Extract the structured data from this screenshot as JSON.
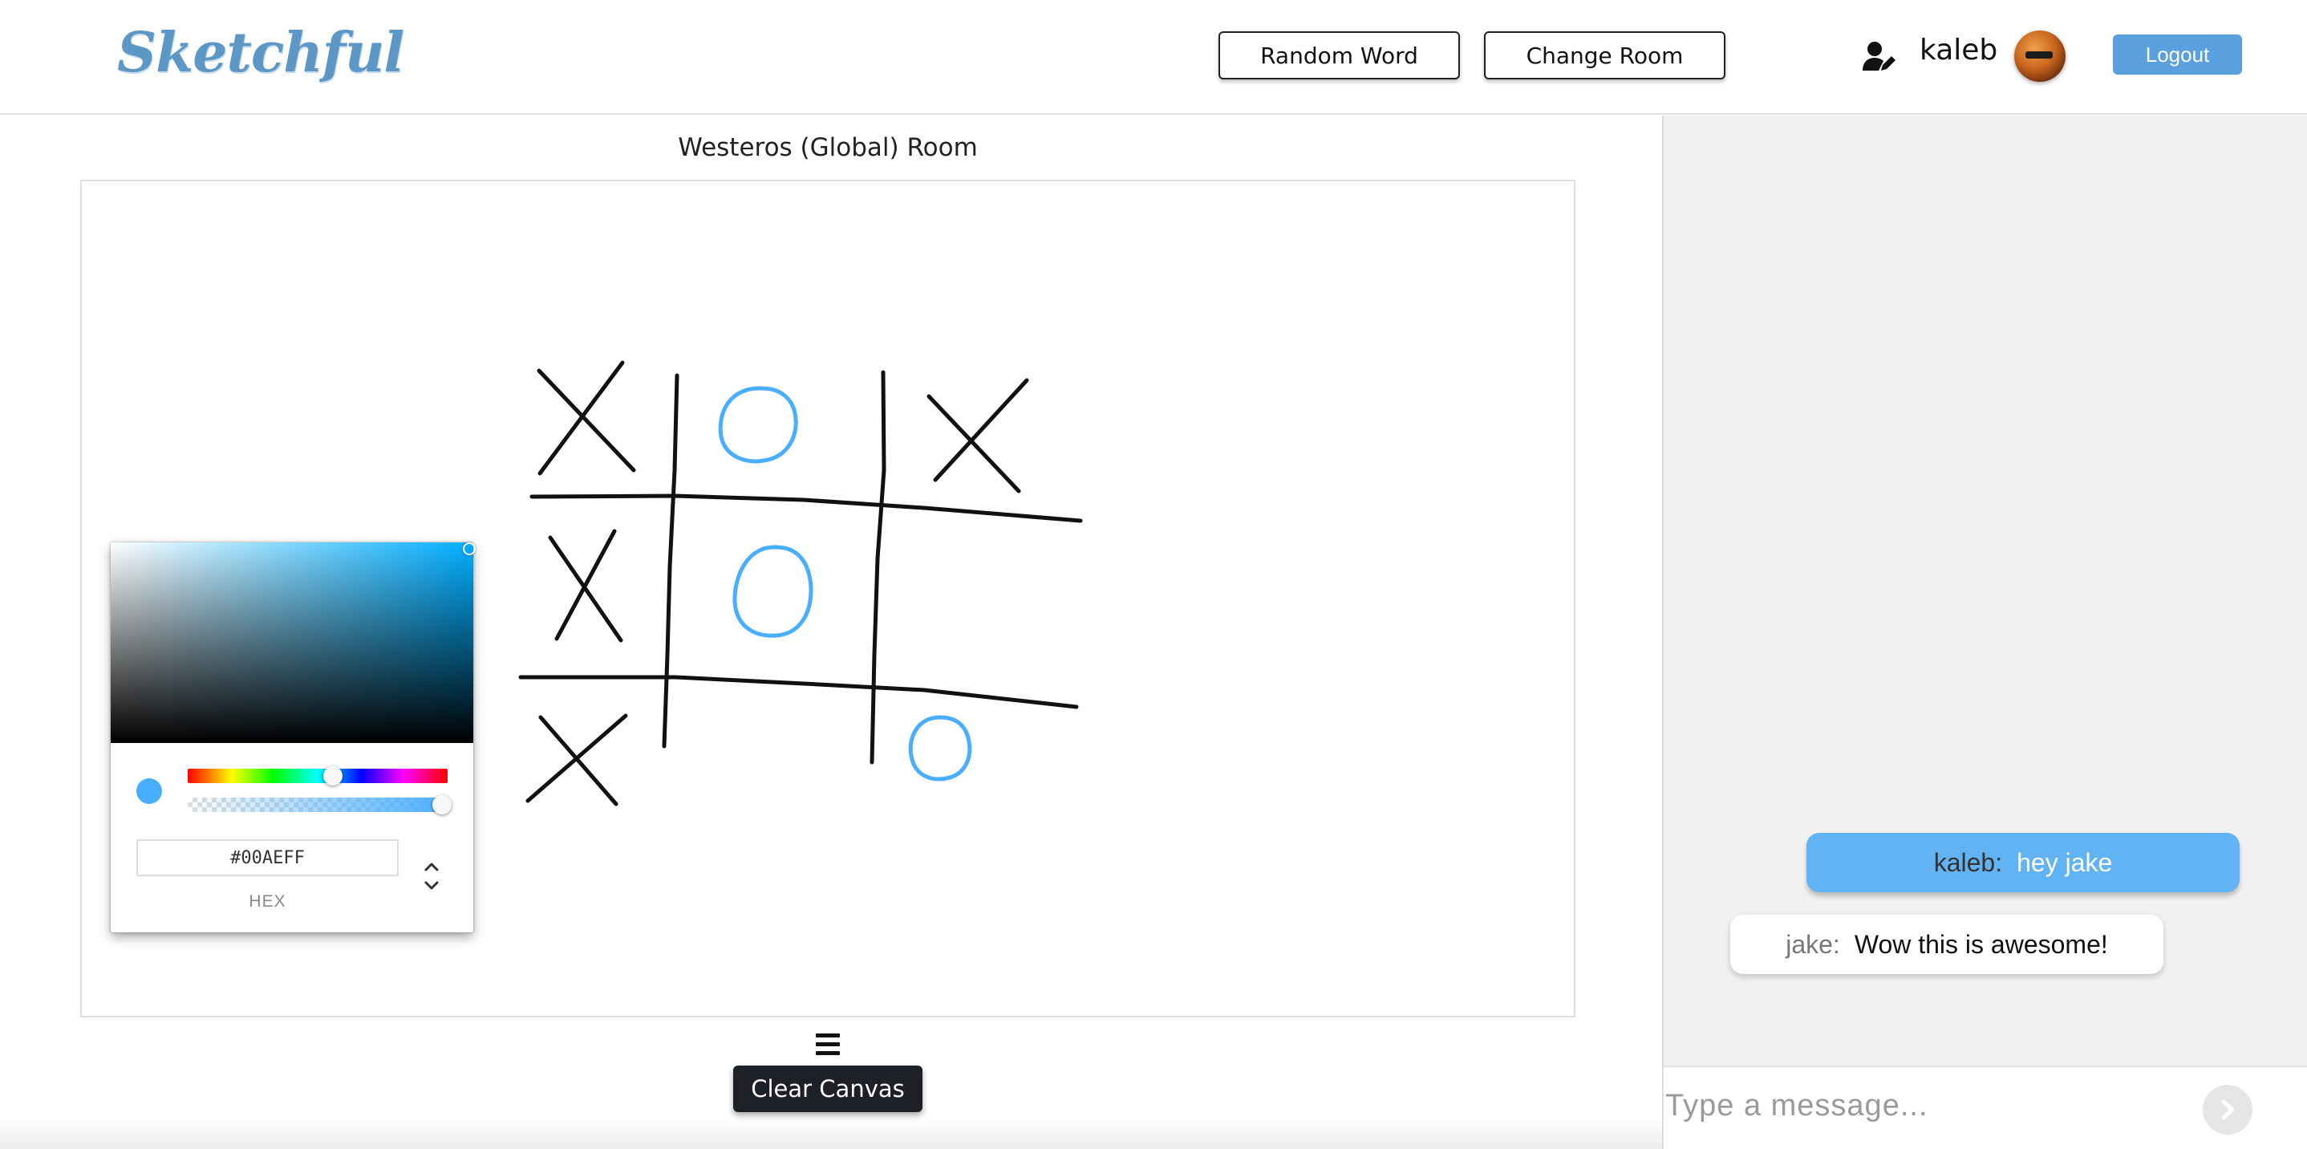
{
  "app": {
    "logo_text": "Sketchful",
    "brand_color": "#5d97c6"
  },
  "header": {
    "random_word_label": "Random Word",
    "change_room_label": "Change Room",
    "user_icon": "user-edit-icon",
    "username": "kaleb",
    "logout_label": "Logout",
    "logout_color": "#5aa0df"
  },
  "room": {
    "title": "Westeros (Global) Room"
  },
  "color_picker": {
    "hex_value": "#00AEFF",
    "mode_label": "HEX",
    "current_color": "#4aaeff",
    "alpha_percent": 100
  },
  "toolbar": {
    "menu_icon": "hamburger-menu-icon",
    "clear_label": "Clear Canvas"
  },
  "chat": {
    "messages": [
      {
        "author": "kaleb:",
        "text": "hey jake",
        "own": true
      },
      {
        "author": "jake:",
        "text": "Wow this is awesome!",
        "own": false
      }
    ],
    "input_placeholder": "Type a message...",
    "send_icon": "chevron-right-icon"
  },
  "drawing": {
    "stroke_colors": {
      "ink": "#111111",
      "blue": "#4aaeff"
    },
    "marks": [
      "X",
      "O",
      "X",
      "X",
      "O",
      "",
      "X",
      "",
      "O"
    ]
  }
}
